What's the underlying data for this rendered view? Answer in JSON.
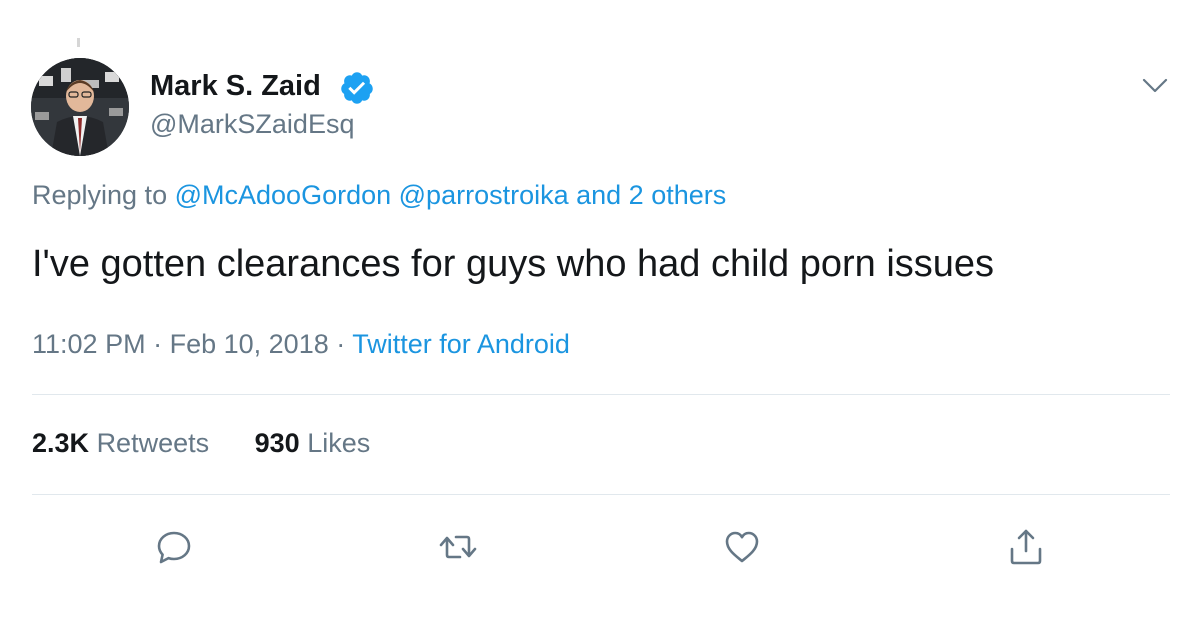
{
  "author": {
    "display_name": "Mark S. Zaid",
    "handle": "@MarkSZaidEsq",
    "verified": true,
    "avatar_icon": "profile-photo"
  },
  "reply": {
    "prefix": "Replying to",
    "mention_1": "@McAdooGordon",
    "mention_2": "@parrostroika",
    "more": "and 2 others"
  },
  "tweet": {
    "text": "I've gotten clearances for guys who had child porn issues"
  },
  "meta": {
    "time": "11:02 PM",
    "separator": "·",
    "date": "Feb 10, 2018",
    "source": "Twitter for Android"
  },
  "stats": {
    "retweets_count": "2.3K",
    "retweets_label": "Retweets",
    "likes_count": "930",
    "likes_label": "Likes"
  },
  "actions": [
    {
      "icon": "reply-icon"
    },
    {
      "icon": "retweet-icon"
    },
    {
      "icon": "like-icon"
    },
    {
      "icon": "share-icon"
    }
  ],
  "colors": {
    "text": "#14171a",
    "secondary": "#657786",
    "link": "#1b95e0",
    "verified": "#1da1f2",
    "divider": "#e1e8ed"
  }
}
